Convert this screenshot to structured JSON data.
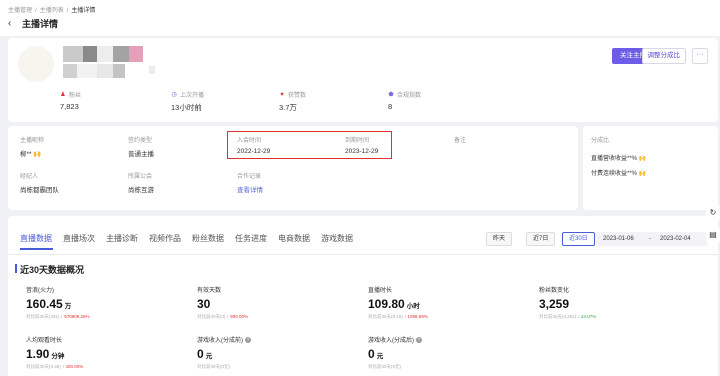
{
  "breadcrumb": {
    "items": [
      "主播管理",
      "主播列表",
      "主播详情"
    ]
  },
  "page": {
    "title": "主播详情",
    "back_icon": "back-arrow-icon"
  },
  "profile": {
    "stats": [
      {
        "label": "粉丝",
        "value": "7,823",
        "icon": "person-icon",
        "color": "#e03131"
      },
      {
        "label": "上次开播",
        "value": "13小时前",
        "icon": "clock-icon",
        "color": "#4a5bd8"
      },
      {
        "label": "获赞数",
        "value": "3.7万",
        "icon": "heart-icon",
        "color": "#e03131"
      },
      {
        "label": "合规指数",
        "value": "8",
        "icon": "shield-icon",
        "color": "#7c6fe0"
      }
    ],
    "buttons": {
      "follow": "关注主播",
      "adjust": "调整分成比",
      "more": "···"
    }
  },
  "info": {
    "fields": [
      {
        "key": "主播昵称",
        "value": "柳** 🙌"
      },
      {
        "key": "签约类型",
        "value": "普通主播"
      },
      {
        "key": "入会时间",
        "value": "2022-12-29"
      },
      {
        "key": "到期时间",
        "value": "2023-12-29"
      },
      {
        "key": "备注",
        "value": ""
      },
      {
        "key": "经纪人",
        "value": "尚栋都霸团队"
      },
      {
        "key": "所属公会",
        "value": "尚栋互游"
      },
      {
        "key": "合作记录",
        "value": "查看详情"
      }
    ]
  },
  "share": {
    "title": "分成比",
    "lines": [
      "直播营收收益**% 🙌",
      "付费连续收益**% 🙌"
    ]
  },
  "tabs": [
    "直播数据",
    "直播场次",
    "主播诊断",
    "视频作品",
    "粉丝数据",
    "任务进度",
    "电商数据",
    "游戏数据"
  ],
  "date_filters": {
    "yesterday": "昨天",
    "last7": "近7日",
    "last30": "近30日"
  },
  "date_range": {
    "start": "2023-01-06",
    "sep": "-",
    "end": "2023-02-04"
  },
  "section": {
    "title": "近30天数据概况"
  },
  "metrics": [
    {
      "label": "音浪(火力)",
      "value": "160.45",
      "unit": "万",
      "cmp_prefix": "对比前30天(281)",
      "change": "↑ 570909.25%",
      "dir": "up"
    },
    {
      "label": "有效天数",
      "value": "30",
      "unit": "",
      "cmp_prefix": "对比前30天(3)",
      "change": "↑ 900.00%",
      "dir": "up"
    },
    {
      "label": "直播时长",
      "value": "109.80",
      "unit": "小时",
      "cmp_prefix": "对比前30天(9.16)",
      "change": "↑ 1098.59%",
      "dir": "up"
    },
    {
      "label": "粉丝数变化",
      "value": "3,259",
      "unit": "",
      "cmp_prefix": "对比前30天(4,262)",
      "change": "↓ 24.07%",
      "dir": "down"
    },
    {
      "label": "人均观看时长",
      "value": "1.90",
      "unit": "分钟",
      "cmp_prefix": "对比前30天(0.38)",
      "change": "↑ 400.00%",
      "dir": "up"
    },
    {
      "label": "游戏收入(分成前)",
      "value": "0",
      "unit": "元",
      "cmp_prefix": "对比前30天(0元)",
      "change": "",
      "dir": "none"
    },
    {
      "label": "游戏收入(分成后)",
      "value": "0",
      "unit": "元",
      "cmp_prefix": "对比前30天(0元)",
      "change": "",
      "dir": "none"
    }
  ]
}
